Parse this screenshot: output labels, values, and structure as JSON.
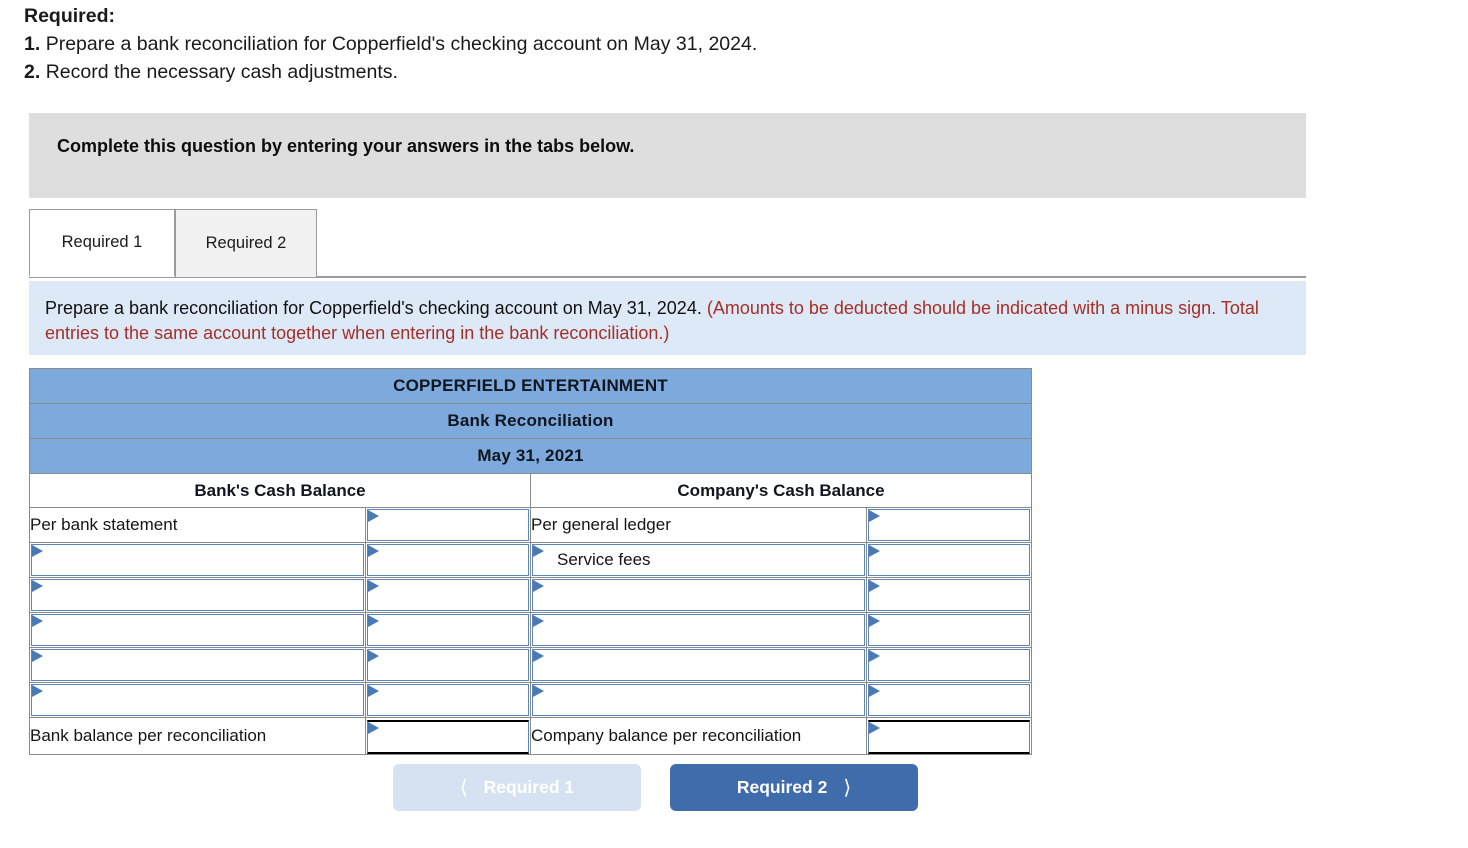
{
  "intro": {
    "heading": "Required:",
    "items": [
      {
        "num": "1.",
        "text": "Prepare a bank reconciliation for Copperfield's checking account on May 31, 2024."
      },
      {
        "num": "2.",
        "text": "Record the necessary cash adjustments."
      }
    ]
  },
  "banner": {
    "text": "Complete this question by entering your answers in the tabs below."
  },
  "tabs": [
    {
      "label": "Required 1",
      "active": true
    },
    {
      "label": "Required 2",
      "active": false
    }
  ],
  "instruction": {
    "black": "Prepare a bank reconciliation for Copperfield's checking account on May 31, 2024.",
    "red": "(Amounts to be deducted should be indicated with a minus sign. Total entries to the same account together when entering in the bank reconciliation.)"
  },
  "table": {
    "title_lines": [
      "COPPERFIELD ENTERTAINMENT",
      "Bank Reconciliation",
      "May 31, 2021"
    ],
    "column_headers": [
      "Bank's Cash Balance",
      "Company's Cash Balance"
    ],
    "rows": [
      {
        "bank_label": "Per bank statement",
        "bank_label_kind": "static",
        "bank_amount": "",
        "company_label": "Per general ledger",
        "company_label_kind": "static",
        "company_amount": ""
      },
      {
        "bank_label": "",
        "bank_label_kind": "select",
        "bank_amount": "",
        "company_label": "Service fees",
        "company_label_kind": "select",
        "company_amount": ""
      },
      {
        "bank_label": "",
        "bank_label_kind": "select",
        "bank_amount": "",
        "company_label": "",
        "company_label_kind": "select",
        "company_amount": ""
      },
      {
        "bank_label": "",
        "bank_label_kind": "select",
        "bank_amount": "",
        "company_label": "",
        "company_label_kind": "select",
        "company_amount": ""
      },
      {
        "bank_label": "",
        "bank_label_kind": "select",
        "bank_amount": "",
        "company_label": "",
        "company_label_kind": "select",
        "company_amount": ""
      },
      {
        "bank_label": "",
        "bank_label_kind": "select",
        "bank_amount": "",
        "company_label": "",
        "company_label_kind": "select",
        "company_amount": ""
      }
    ],
    "total_row": {
      "bank_label": "Bank balance per reconciliation",
      "bank_amount": "",
      "company_label": "Company balance per reconciliation",
      "company_amount": ""
    }
  },
  "nav": {
    "prev_label": "Required 1",
    "prev_icon": "chevron-left-icon",
    "prev_disabled": true,
    "next_label": "Required 2",
    "next_icon": "chevron-right-icon"
  },
  "colors": {
    "table_header_blue": "#7ea9dd",
    "info_panel_blue": "#dee9f7",
    "banner_gray": "#dedede",
    "red_note": "#a33028",
    "next_button_blue": "#3f6cab",
    "prev_button_blue": "#d6e2f1",
    "input_border_blue": "#5b86bd",
    "marker_blue": "#4a7ab5"
  }
}
